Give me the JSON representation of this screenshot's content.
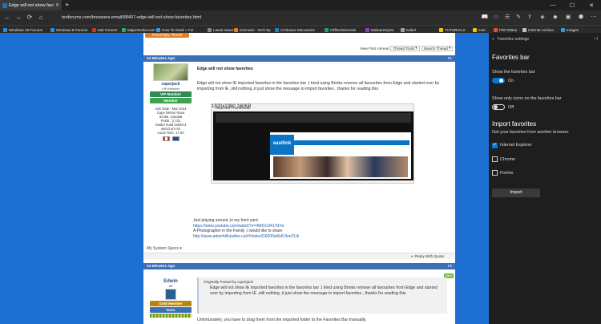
{
  "window": {
    "tab_title": "Edge will not show favo",
    "new_tab": "+",
    "minimize": "—",
    "maximize": "☐",
    "close": "✕",
    "tab_close": "✕"
  },
  "addressbar": {
    "url": "tenforums.com/browsers-email/88407-edge-will-not-show-favorites.html",
    "back": "←",
    "forward": "→",
    "refresh": "⟳",
    "home": "⌂"
  },
  "bookmarks": [
    "Windows 10 Forums",
    "Windows 8 Forums",
    "Mal Forums",
    "MajorGeeks.com",
    "How-To Geek » For",
    "Latest News",
    "Gizmodo - Tech By",
    "CCleaner Discussion",
    "CliffordSimonds",
    "Malwaretryies",
    "Kabel",
    "TUTORIALS",
    "mon",
    "FRITZ!Box",
    "Internet Archive",
    "Images"
  ],
  "thread": {
    "top_button": "Post Reply Thread",
    "view_first_unread": "View First Unread",
    "thread_tools": "Thread Tools",
    "search_thread": "Search Thread",
    "post1": {
      "time": "24 Minutes Ago",
      "number": "#1",
      "username": "caperjack",
      "user_title": "VIP Member",
      "rank1": "VIP Member",
      "rank2": "Member",
      "join_date": "Join Date : Mar 2014",
      "location1": "Cape Breton Nova",
      "location2": "Scotia ,Canada",
      "posts": "Posts : 2,731",
      "insider": "insider build 15058.3",
      "os": "win10 pro 64",
      "local_time": "Local Time: 17:00",
      "title": "Edge will not show favorites",
      "body": "Edge will not show IE imported favorites in the favorites bar ,I tried using Brinks remove all favourites from Edge and started over by importing from IE ,still nothing ,it just show the message to import favorites , thanks for reading this",
      "attached_label": "Attached Thumbnails",
      "thumb_caption": "1920x1080 160KB",
      "site_logo": "eastlink",
      "sig1": "Just playing around ,in my front yard",
      "sig2": "https://www.youtube.com/watch?v=4WGC9417d7w",
      "sig3": "A Photographer in the Family ,I would like to share",
      "sig4": "http://www.adamhillstudios.ca/#!/index/G0000wRdC4xnCUk",
      "specs": "My System Specs",
      "reply": "Reply With Quote"
    },
    "post2": {
      "time": "14 Minutes Ago",
      "number": "#2",
      "username": "Edwin",
      "user_title": "♦♦",
      "rank1": "Gold Member",
      "rank2": "Guru",
      "badge": "New",
      "quote_by": "Originally Posted by caperjack",
      "quote": "Edge will not show IE imported favorites in the favorites bar ,I tried using Brinks remove all favourites from Edge and started over by importing from IE ,still nothing ,it just show the message to import favorites , thanks for reading this",
      "body": "Unfortunately, you have to drag them from the imported folder to the Favorites Bar manually."
    }
  },
  "pane": {
    "back": "«",
    "header": "Favorites settings",
    "pin": "⊣",
    "favbar_heading": "Favorites bar",
    "show_bar_label": "Show the favorites bar",
    "show_bar_state": "On",
    "icons_only_label": "Show only icons on the favorites bar",
    "icons_only_state": "Off",
    "import_heading": "Import favorites",
    "import_desc": "Get your favorites from another browser.",
    "browsers": [
      "Internet Explorer",
      "Chrome",
      "Firefox"
    ],
    "browser_checked": [
      true,
      false,
      false
    ],
    "import_button": "Import",
    "colors": {
      "toggle_on": "#0078d7",
      "accent": "#1d6fd1"
    }
  }
}
